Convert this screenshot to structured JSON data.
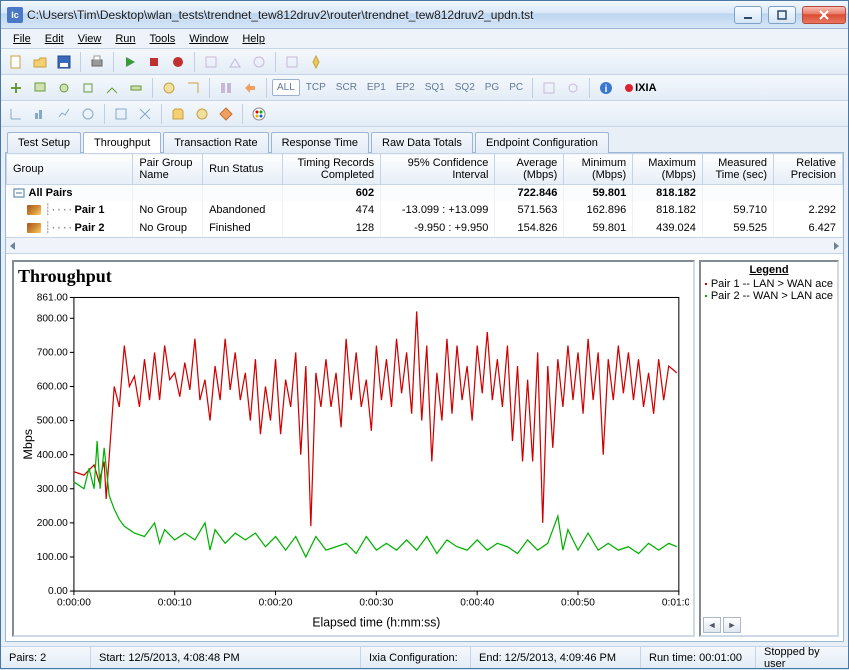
{
  "window": {
    "title": "C:\\Users\\Tim\\Desktop\\wlan_tests\\trendnet_tew812druv2\\router\\trendnet_tew812druv2_updn.tst"
  },
  "menu": [
    "File",
    "Edit",
    "View",
    "Run",
    "Tools",
    "Window",
    "Help"
  ],
  "filter_buttons": [
    "ALL",
    "TCP",
    "SCR",
    "EP1",
    "EP2",
    "SQ1",
    "SQ2",
    "PG",
    "PC"
  ],
  "brand": "IXIA",
  "tabs": [
    "Test Setup",
    "Throughput",
    "Transaction Rate",
    "Response Time",
    "Raw Data Totals",
    "Endpoint Configuration"
  ],
  "active_tab_index": 1,
  "grid": {
    "headers": [
      "Group",
      "Pair Group Name",
      "Run Status",
      "Timing Records Completed",
      "95% Confidence Interval",
      "Average (Mbps)",
      "Minimum (Mbps)",
      "Maximum (Mbps)",
      "Measured Time (sec)",
      "Relative Precision"
    ],
    "rows": [
      {
        "group": "All Pairs",
        "pair_group": "",
        "run_status": "",
        "timing": "602",
        "ci": "",
        "avg": "722.846",
        "min": "59.801",
        "max": "818.182",
        "time": "",
        "prec": "",
        "bold": true,
        "indent": 0
      },
      {
        "group": "Pair 1",
        "pair_group": "No Group",
        "run_status": "Abandoned",
        "timing": "474",
        "ci": "-13.099 : +13.099",
        "avg": "571.563",
        "min": "162.896",
        "max": "818.182",
        "time": "59.710",
        "prec": "2.292",
        "bold": false,
        "indent": 1
      },
      {
        "group": "Pair 2",
        "pair_group": "No Group",
        "run_status": "Finished",
        "timing": "128",
        "ci": "-9.950 : +9.950",
        "avg": "154.826",
        "min": "59.801",
        "max": "439.024",
        "time": "59.525",
        "prec": "6.427",
        "bold": false,
        "indent": 1
      }
    ]
  },
  "chart_data": {
    "type": "line",
    "title": "Throughput",
    "xlabel": "Elapsed time (h:mm:ss)",
    "ylabel": "Mbps",
    "ylim": [
      0,
      861
    ],
    "y_ticks": [
      0,
      100,
      200,
      300,
      400,
      500,
      600,
      700,
      800,
      861
    ],
    "x_ticks": [
      "0:00:00",
      "0:00:10",
      "0:00:20",
      "0:00:30",
      "0:00:40",
      "0:00:50",
      "0:01:00"
    ],
    "x_range_sec": [
      0,
      60
    ],
    "series": [
      {
        "name": "Pair 1 -- LAN > WAN ace",
        "color": "#d00000",
        "values": [
          [
            0,
            350
          ],
          [
            1,
            340
          ],
          [
            2,
            370
          ],
          [
            2.5,
            320
          ],
          [
            3,
            380
          ],
          [
            3.2,
            270
          ],
          [
            4,
            600
          ],
          [
            4.5,
            540
          ],
          [
            5,
            720
          ],
          [
            5.5,
            600
          ],
          [
            6,
            630
          ],
          [
            6.5,
            540
          ],
          [
            7,
            680
          ],
          [
            7.5,
            560
          ],
          [
            8,
            700
          ],
          [
            8.5,
            560
          ],
          [
            9,
            720
          ],
          [
            9.5,
            620
          ],
          [
            10,
            640
          ],
          [
            10.5,
            570
          ],
          [
            11,
            670
          ],
          [
            11.5,
            590
          ],
          [
            12,
            740
          ],
          [
            12.5,
            560
          ],
          [
            13,
            620
          ],
          [
            13.5,
            500
          ],
          [
            14,
            660
          ],
          [
            14.5,
            560
          ],
          [
            15,
            740
          ],
          [
            15.5,
            590
          ],
          [
            16,
            700
          ],
          [
            16.5,
            560
          ],
          [
            17,
            640
          ],
          [
            17.5,
            500
          ],
          [
            18,
            680
          ],
          [
            18.5,
            460
          ],
          [
            19,
            600
          ],
          [
            19.5,
            500
          ],
          [
            20,
            680
          ],
          [
            20.5,
            460
          ],
          [
            21,
            620
          ],
          [
            21.5,
            540
          ],
          [
            22,
            700
          ],
          [
            22.5,
            400
          ],
          [
            23,
            660
          ],
          [
            23.5,
            190
          ],
          [
            24,
            640
          ],
          [
            24.5,
            540
          ],
          [
            25,
            680
          ],
          [
            25.5,
            540
          ],
          [
            26,
            640
          ],
          [
            26.5,
            480
          ],
          [
            27,
            740
          ],
          [
            27.5,
            560
          ],
          [
            28,
            700
          ],
          [
            28.5,
            540
          ],
          [
            29,
            620
          ],
          [
            29.5,
            470
          ],
          [
            30,
            720
          ],
          [
            30.5,
            560
          ],
          [
            31,
            680
          ],
          [
            31.5,
            540
          ],
          [
            32,
            740
          ],
          [
            32.5,
            580
          ],
          [
            33,
            700
          ],
          [
            33.5,
            520
          ],
          [
            34,
            820
          ],
          [
            34.5,
            500
          ],
          [
            35,
            720
          ],
          [
            35.5,
            380
          ],
          [
            36,
            640
          ],
          [
            36.5,
            500
          ],
          [
            37,
            740
          ],
          [
            37.5,
            520
          ],
          [
            38,
            720
          ],
          [
            38.5,
            560
          ],
          [
            39,
            660
          ],
          [
            39.5,
            500
          ],
          [
            40,
            720
          ],
          [
            40.5,
            580
          ],
          [
            41,
            760
          ],
          [
            41.5,
            560
          ],
          [
            42,
            680
          ],
          [
            42.5,
            540
          ],
          [
            43,
            720
          ],
          [
            43.5,
            440
          ],
          [
            44,
            660
          ],
          [
            44.5,
            380
          ],
          [
            45,
            620
          ],
          [
            45.5,
            380
          ],
          [
            46,
            700
          ],
          [
            46.5,
            200
          ],
          [
            47,
            660
          ],
          [
            47.5,
            420
          ],
          [
            48,
            680
          ],
          [
            48.5,
            540
          ],
          [
            49,
            720
          ],
          [
            49.5,
            560
          ],
          [
            50,
            700
          ],
          [
            50.5,
            520
          ],
          [
            51,
            740
          ],
          [
            51.5,
            560
          ],
          [
            52,
            700
          ],
          [
            52.5,
            400
          ],
          [
            53,
            680
          ],
          [
            53.5,
            560
          ],
          [
            54,
            720
          ],
          [
            54.5,
            580
          ],
          [
            55,
            700
          ],
          [
            55.5,
            560
          ],
          [
            56,
            680
          ],
          [
            56.5,
            540
          ],
          [
            57,
            640
          ],
          [
            57.5,
            520
          ],
          [
            58,
            680
          ],
          [
            58.5,
            560
          ],
          [
            59,
            660
          ],
          [
            59.8,
            640
          ]
        ]
      },
      {
        "name": "Pair 2 -- WAN > LAN ace",
        "color": "#00b000",
        "values": [
          [
            0,
            320
          ],
          [
            1,
            300
          ],
          [
            1.5,
            360
          ],
          [
            2,
            300
          ],
          [
            2.3,
            440
          ],
          [
            2.6,
            300
          ],
          [
            3,
            420
          ],
          [
            3.5,
            280
          ],
          [
            4,
            240
          ],
          [
            4.5,
            210
          ],
          [
            5,
            190
          ],
          [
            5.5,
            180
          ],
          [
            6,
            170
          ],
          [
            7,
            160
          ],
          [
            8,
            200
          ],
          [
            8.5,
            140
          ],
          [
            9,
            180
          ],
          [
            10,
            150
          ],
          [
            11,
            170
          ],
          [
            12,
            150
          ],
          [
            13,
            200
          ],
          [
            13.5,
            120
          ],
          [
            14,
            180
          ],
          [
            15,
            140
          ],
          [
            16,
            170
          ],
          [
            17,
            150
          ],
          [
            18,
            170
          ],
          [
            19,
            130
          ],
          [
            20,
            160
          ],
          [
            21,
            120
          ],
          [
            22,
            160
          ],
          [
            23,
            100
          ],
          [
            24,
            160
          ],
          [
            25,
            120
          ],
          [
            26,
            130
          ],
          [
            27,
            140
          ],
          [
            28,
            110
          ],
          [
            29,
            160
          ],
          [
            30,
            120
          ],
          [
            31,
            140
          ],
          [
            32,
            120
          ],
          [
            33,
            150
          ],
          [
            34,
            120
          ],
          [
            35,
            160
          ],
          [
            36,
            110
          ],
          [
            37,
            150
          ],
          [
            38,
            130
          ],
          [
            39,
            120
          ],
          [
            40,
            150
          ],
          [
            41,
            120
          ],
          [
            42,
            140
          ],
          [
            43,
            130
          ],
          [
            44,
            110
          ],
          [
            45,
            150
          ],
          [
            46,
            120
          ],
          [
            47,
            140
          ],
          [
            48,
            220
          ],
          [
            48.5,
            120
          ],
          [
            49,
            180
          ],
          [
            50,
            120
          ],
          [
            51,
            170
          ],
          [
            52,
            120
          ],
          [
            53,
            140
          ],
          [
            54,
            120
          ],
          [
            55,
            130
          ],
          [
            56,
            110
          ],
          [
            57,
            140
          ],
          [
            58,
            120
          ],
          [
            59,
            140
          ],
          [
            59.8,
            130
          ]
        ]
      }
    ]
  },
  "legend": {
    "title": "Legend",
    "items": [
      {
        "color": "#d00000",
        "label": "Pair 1 -- LAN > WAN ace"
      },
      {
        "color": "#00b000",
        "label": "Pair 2 -- WAN > LAN ace"
      }
    ]
  },
  "status": {
    "pairs_label": "Pairs: 2",
    "start": "Start: 12/5/2013, 4:08:48 PM",
    "ixia_config": "Ixia Configuration:",
    "end": "End: 12/5/2013, 4:09:46 PM",
    "runtime": "Run time: 00:01:00",
    "stopped": "Stopped by user"
  }
}
